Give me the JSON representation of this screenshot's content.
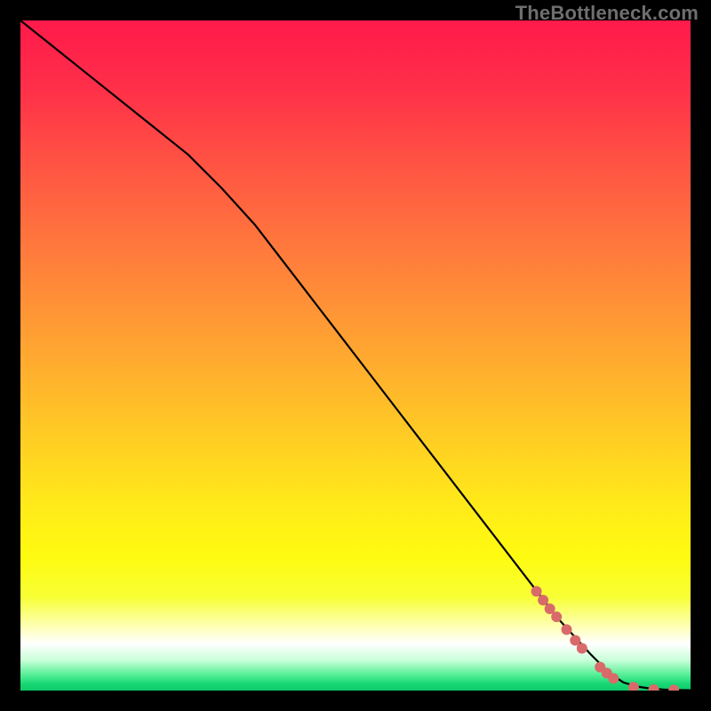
{
  "watermark": "TheBottleneck.com",
  "colors": {
    "gradient_stops": [
      {
        "offset": 0.0,
        "color": "#ff1a4b"
      },
      {
        "offset": 0.1,
        "color": "#ff2f49"
      },
      {
        "offset": 0.22,
        "color": "#ff5543"
      },
      {
        "offset": 0.35,
        "color": "#ff7c3c"
      },
      {
        "offset": 0.48,
        "color": "#ffa232"
      },
      {
        "offset": 0.6,
        "color": "#ffc626"
      },
      {
        "offset": 0.72,
        "color": "#ffe91a"
      },
      {
        "offset": 0.8,
        "color": "#fffb10"
      },
      {
        "offset": 0.86,
        "color": "#f7ff34"
      },
      {
        "offset": 0.9,
        "color": "#fdffa8"
      },
      {
        "offset": 0.93,
        "color": "#ffffff"
      },
      {
        "offset": 0.955,
        "color": "#c8ffd8"
      },
      {
        "offset": 0.975,
        "color": "#5cf09a"
      },
      {
        "offset": 0.99,
        "color": "#17d873"
      },
      {
        "offset": 1.0,
        "color": "#0fca6a"
      }
    ],
    "line": "#000000",
    "marker_fill": "#d96a6a",
    "marker_stroke": "#b24e4e"
  },
  "chart_data": {
    "type": "line",
    "title": "",
    "xlabel": "",
    "ylabel": "",
    "xlim": [
      0,
      100
    ],
    "ylim": [
      0,
      100
    ],
    "grid": false,
    "series": [
      {
        "name": "curve",
        "x": [
          0,
          5,
          10,
          15,
          20,
          25,
          30,
          35,
          40,
          45,
          50,
          55,
          60,
          65,
          70,
          75,
          80,
          85,
          88,
          90,
          92,
          94,
          96,
          98,
          100
        ],
        "y": [
          100,
          96,
          92,
          88,
          84,
          80,
          75,
          69.5,
          63,
          56.5,
          50,
          43.5,
          37,
          30.5,
          24,
          17.5,
          11,
          5.5,
          2.5,
          1.2,
          0.6,
          0.3,
          0.15,
          0.08,
          0.05
        ]
      }
    ],
    "markers": [
      {
        "x": 77.0,
        "y": 14.8,
        "r": 6
      },
      {
        "x": 78.0,
        "y": 13.5,
        "r": 6
      },
      {
        "x": 79.0,
        "y": 12.2,
        "r": 6
      },
      {
        "x": 80.0,
        "y": 11.0,
        "r": 6
      },
      {
        "x": 81.5,
        "y": 9.1,
        "r": 6
      },
      {
        "x": 82.8,
        "y": 7.5,
        "r": 6
      },
      {
        "x": 83.8,
        "y": 6.3,
        "r": 6
      },
      {
        "x": 86.5,
        "y": 3.5,
        "r": 6
      },
      {
        "x": 87.5,
        "y": 2.6,
        "r": 6
      },
      {
        "x": 88.5,
        "y": 1.8,
        "r": 6
      },
      {
        "x": 91.5,
        "y": 0.5,
        "r": 6
      },
      {
        "x": 94.5,
        "y": 0.15,
        "r": 6
      },
      {
        "x": 97.5,
        "y": 0.08,
        "r": 6
      }
    ]
  }
}
